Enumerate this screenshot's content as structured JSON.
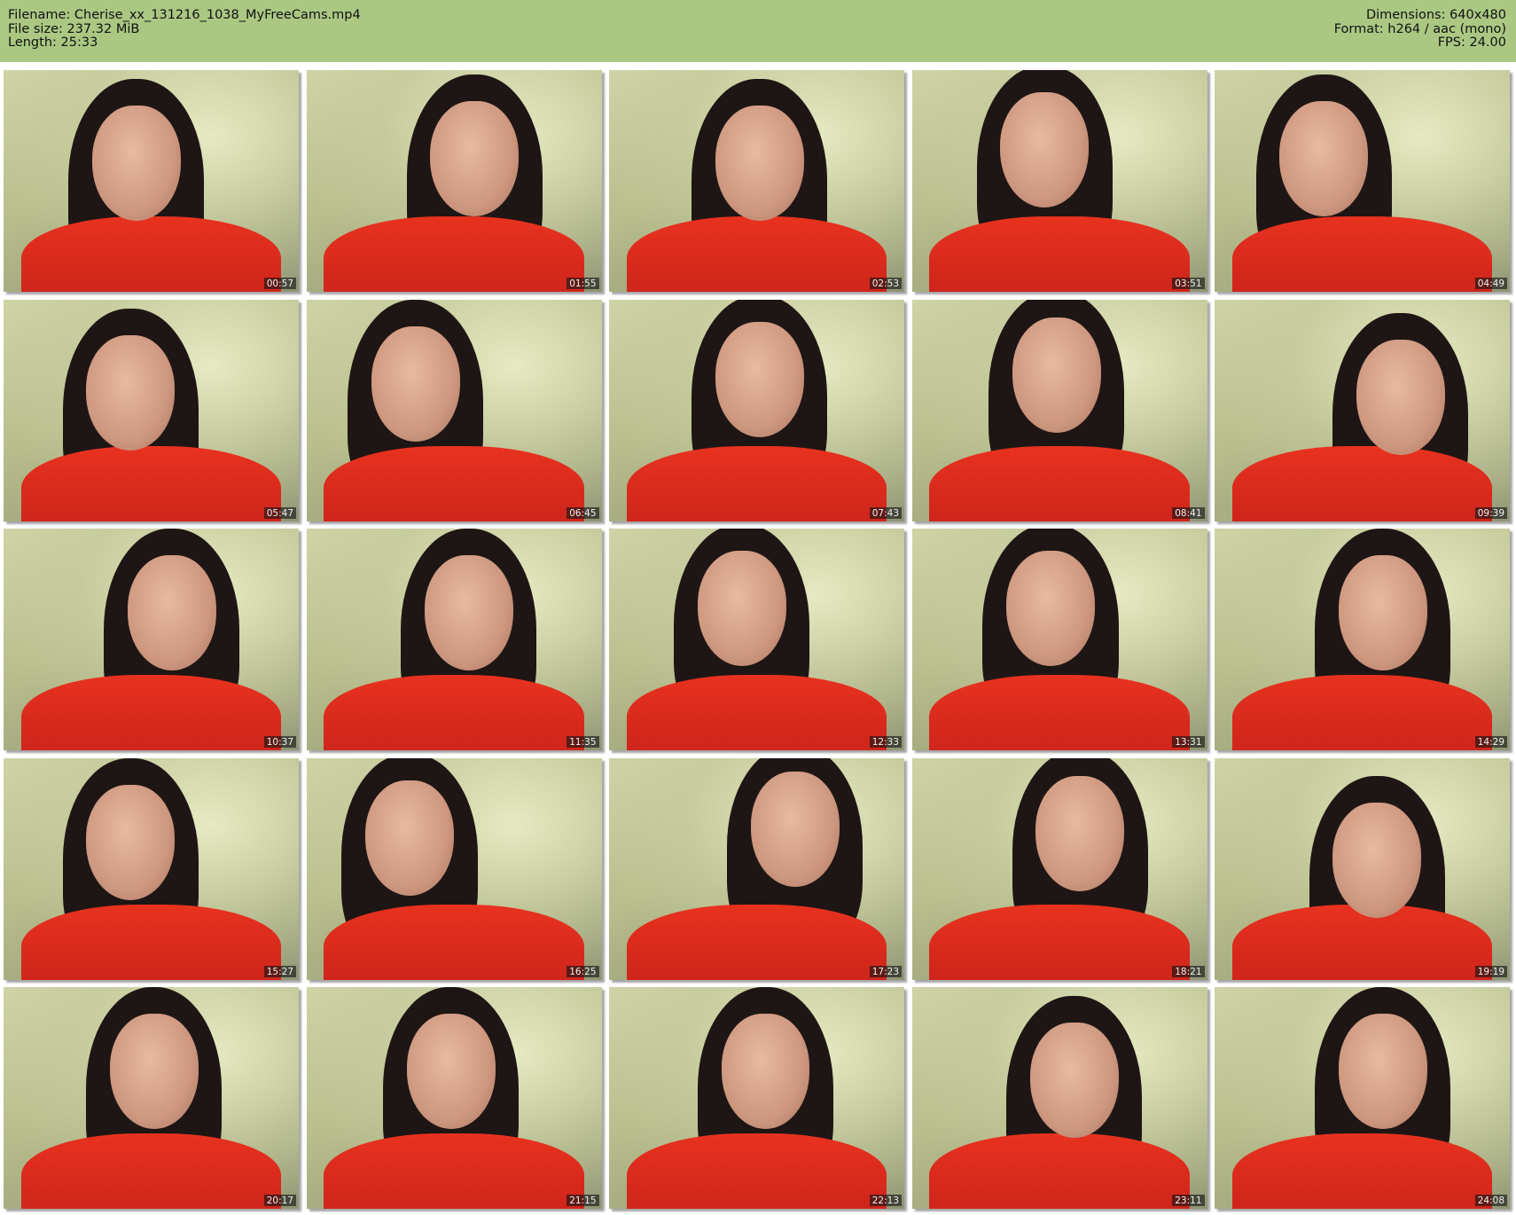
{
  "header": {
    "filename_line": "Filename: Cherise_xx_131216_1038_MyFreeCams.mp4",
    "filesize_line": "File size: 237.32 MiB",
    "length_line": "Length: 25:33",
    "dimensions_line": "Dimensions: 640x480",
    "format_line": "Format: h264 / aac (mono)",
    "fps_line": "FPS: 24.00"
  },
  "colors": {
    "header_bg": "#aac882",
    "shirt": "#e8321f",
    "wall": "#cfd3a6"
  },
  "thumbnails": [
    {
      "timestamp": "00:57"
    },
    {
      "timestamp": "01:55"
    },
    {
      "timestamp": "02:53"
    },
    {
      "timestamp": "03:51"
    },
    {
      "timestamp": "04:49"
    },
    {
      "timestamp": "05:47"
    },
    {
      "timestamp": "06:45"
    },
    {
      "timestamp": "07:43"
    },
    {
      "timestamp": "08:41"
    },
    {
      "timestamp": "09:39"
    },
    {
      "timestamp": "10:37"
    },
    {
      "timestamp": "11:35"
    },
    {
      "timestamp": "12:33"
    },
    {
      "timestamp": "13:31"
    },
    {
      "timestamp": "14:29"
    },
    {
      "timestamp": "15:27"
    },
    {
      "timestamp": "16:25"
    },
    {
      "timestamp": "17:23"
    },
    {
      "timestamp": "18:21"
    },
    {
      "timestamp": "19:19"
    },
    {
      "timestamp": "20:17"
    },
    {
      "timestamp": "21:15"
    },
    {
      "timestamp": "22:13"
    },
    {
      "timestamp": "23:11"
    },
    {
      "timestamp": "24:08"
    }
  ]
}
